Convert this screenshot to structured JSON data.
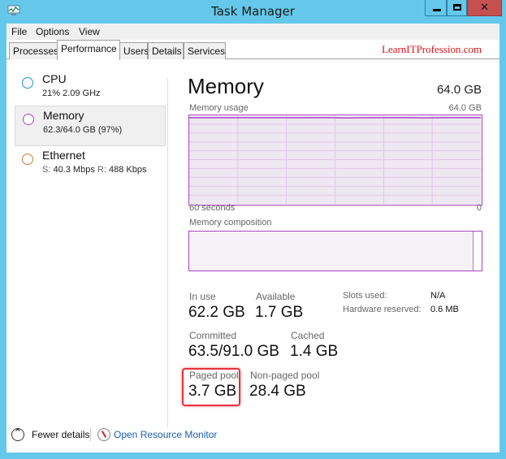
{
  "window": {
    "title": "Task Manager",
    "controls": {
      "minimize": "minimize",
      "maximize": "maximize",
      "close": "✕"
    }
  },
  "menu": [
    "File",
    "Options",
    "View"
  ],
  "tabs": [
    {
      "label": "Processes",
      "active": false
    },
    {
      "label": "Performance",
      "active": true
    },
    {
      "label": "Users",
      "active": false
    },
    {
      "label": "Details",
      "active": false
    },
    {
      "label": "Services",
      "active": false
    }
  ],
  "watermark": "LearnITProfession.com",
  "sidebar": {
    "items": [
      {
        "title": "CPU",
        "subtitle": "21% 2.09 GHz",
        "color": "#1e8fd8",
        "selected": false
      },
      {
        "title": "Memory",
        "subtitle": "62.3/64.0 GB (97%)",
        "color": "#a845c8",
        "selected": true
      },
      {
        "title": "Ethernet",
        "subtitle_s_label": "S:",
        "subtitle_s_value": "40.3 Mbps",
        "subtitle_r_label": "R:",
        "subtitle_r_value": "488 Kbps",
        "color": "#c8823a",
        "selected": false
      }
    ]
  },
  "panel": {
    "title": "Memory",
    "total": "64.0 GB",
    "usage_label": "Memory usage",
    "usage_max": "64.0 GB",
    "time_left": "60 seconds",
    "time_right": "0",
    "composition_label": "Memory composition",
    "accent": "#a845c8"
  },
  "chart_data": {
    "type": "line",
    "title": "Memory usage",
    "xlabel": "",
    "ylabel": "",
    "x_range_label": [
      "60 seconds",
      "0"
    ],
    "ylim": [
      0,
      64.0
    ],
    "y_unit": "GB",
    "series": [
      {
        "name": "Memory in use",
        "values": [
          62.3,
          62.3,
          62.3,
          62.3,
          62.3,
          62.3,
          62.3,
          62.4,
          62.2,
          62.3,
          62.3,
          62.4,
          62.2,
          62.3,
          62.4,
          62.3
        ]
      }
    ],
    "grid": true,
    "composition": {
      "in_use_fraction": 0.97,
      "free_fraction": 0.03
    }
  },
  "stats": {
    "in_use": {
      "label": "In use",
      "value": "62.2 GB"
    },
    "available": {
      "label": "Available",
      "value": "1.7 GB"
    },
    "committed": {
      "label": "Committed",
      "value": "63.5/91.0 GB"
    },
    "cached": {
      "label": "Cached",
      "value": "1.4 GB"
    },
    "paged_pool": {
      "label": "Paged pool",
      "value": "3.7 GB"
    },
    "non_paged_pool": {
      "label": "Non-paged pool",
      "value": "28.4 GB"
    },
    "slots_used": {
      "label": "Slots used:",
      "value": "N/A"
    },
    "hardware_reserved": {
      "label": "Hardware reserved:",
      "value": "0.6 MB"
    }
  },
  "footer": {
    "fewer_details": "Fewer details",
    "open_resource_monitor": "Open Resource Monitor"
  }
}
